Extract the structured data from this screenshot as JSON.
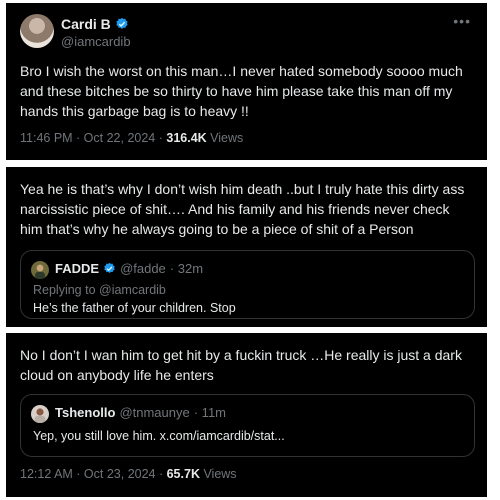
{
  "tweet1": {
    "name": "Cardi B",
    "handle": "@iamcardib",
    "more_icon": "ellipsis-icon",
    "text": "Bro I wish the worst on this man…I never hated somebody soooo much and these bitches be so thirty to have him please take  this man off my hands this garbage bag  is to heavy !!",
    "time": "11:46 PM · Oct 22, 2024 · ",
    "views_count": "316.4K",
    "views_label": " Views"
  },
  "tweet2": {
    "text": "Yea he is that’s why I don’t wish him death ..but I truly hate this dirty ass narcissistic piece of shit…. And his family and his friends never check him that’s why he always going to be a piece of shit of a Person",
    "quote": {
      "name": "FADDE",
      "handle": "@fadde",
      "time": "· 32m",
      "replying_to": "Replying to @iamcardib",
      "text": "He’s the father of your children. Stop"
    }
  },
  "tweet3": {
    "text": "No I don’t I wan him to get hit by a fuckin truck …He really is just a dark cloud on anybody life he enters",
    "quote": {
      "name": "Tshenollo",
      "handle": "@tnmaunye",
      "time": "· 11m",
      "text": "Yep, you still love him. x.com/iamcardib/stat..."
    },
    "time": "12:12 AM · Oct 23, 2024 · ",
    "views_count": "65.7K",
    "views_label": " Views"
  },
  "colors": {
    "background": "#000000",
    "text": "#e7e9ea",
    "muted": "#71767b",
    "verified": "#1d9bf0",
    "border": "#2f3336"
  }
}
